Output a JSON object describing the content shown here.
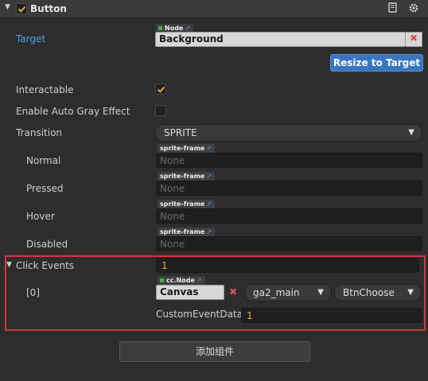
{
  "component": {
    "title": "Button",
    "enabled": true
  },
  "target": {
    "label": "Target",
    "tag": "Node",
    "value": "Background"
  },
  "resize_button": "Resize to Target",
  "interactable": {
    "label": "Interactable",
    "checked": true
  },
  "auto_gray": {
    "label": "Enable Auto Gray Effect",
    "checked": false
  },
  "transition": {
    "label": "Transition",
    "value": "SPRITE"
  },
  "sprites": [
    {
      "label": "Normal",
      "tag": "sprite-frame",
      "value": "None"
    },
    {
      "label": "Pressed",
      "tag": "sprite-frame",
      "value": "None"
    },
    {
      "label": "Hover",
      "tag": "sprite-frame",
      "value": "None"
    },
    {
      "label": "Disabled",
      "tag": "sprite-frame",
      "value": "None"
    }
  ],
  "click_events": {
    "label": "Click Events",
    "count": "1",
    "item_label": "[0]",
    "node_tag": "cc.Node",
    "node_value": "Canvas",
    "component_value": "ga2_main",
    "handler_value": "BtnChoose",
    "custom_label": "CustomEventData",
    "custom_value": "1"
  },
  "add_component_button": "添加组件",
  "colors": {
    "accent_blue": "#3876c2",
    "link_blue": "#4aa3df",
    "highlight_red": "#d9363e",
    "check_orange": "#f0a93a"
  }
}
